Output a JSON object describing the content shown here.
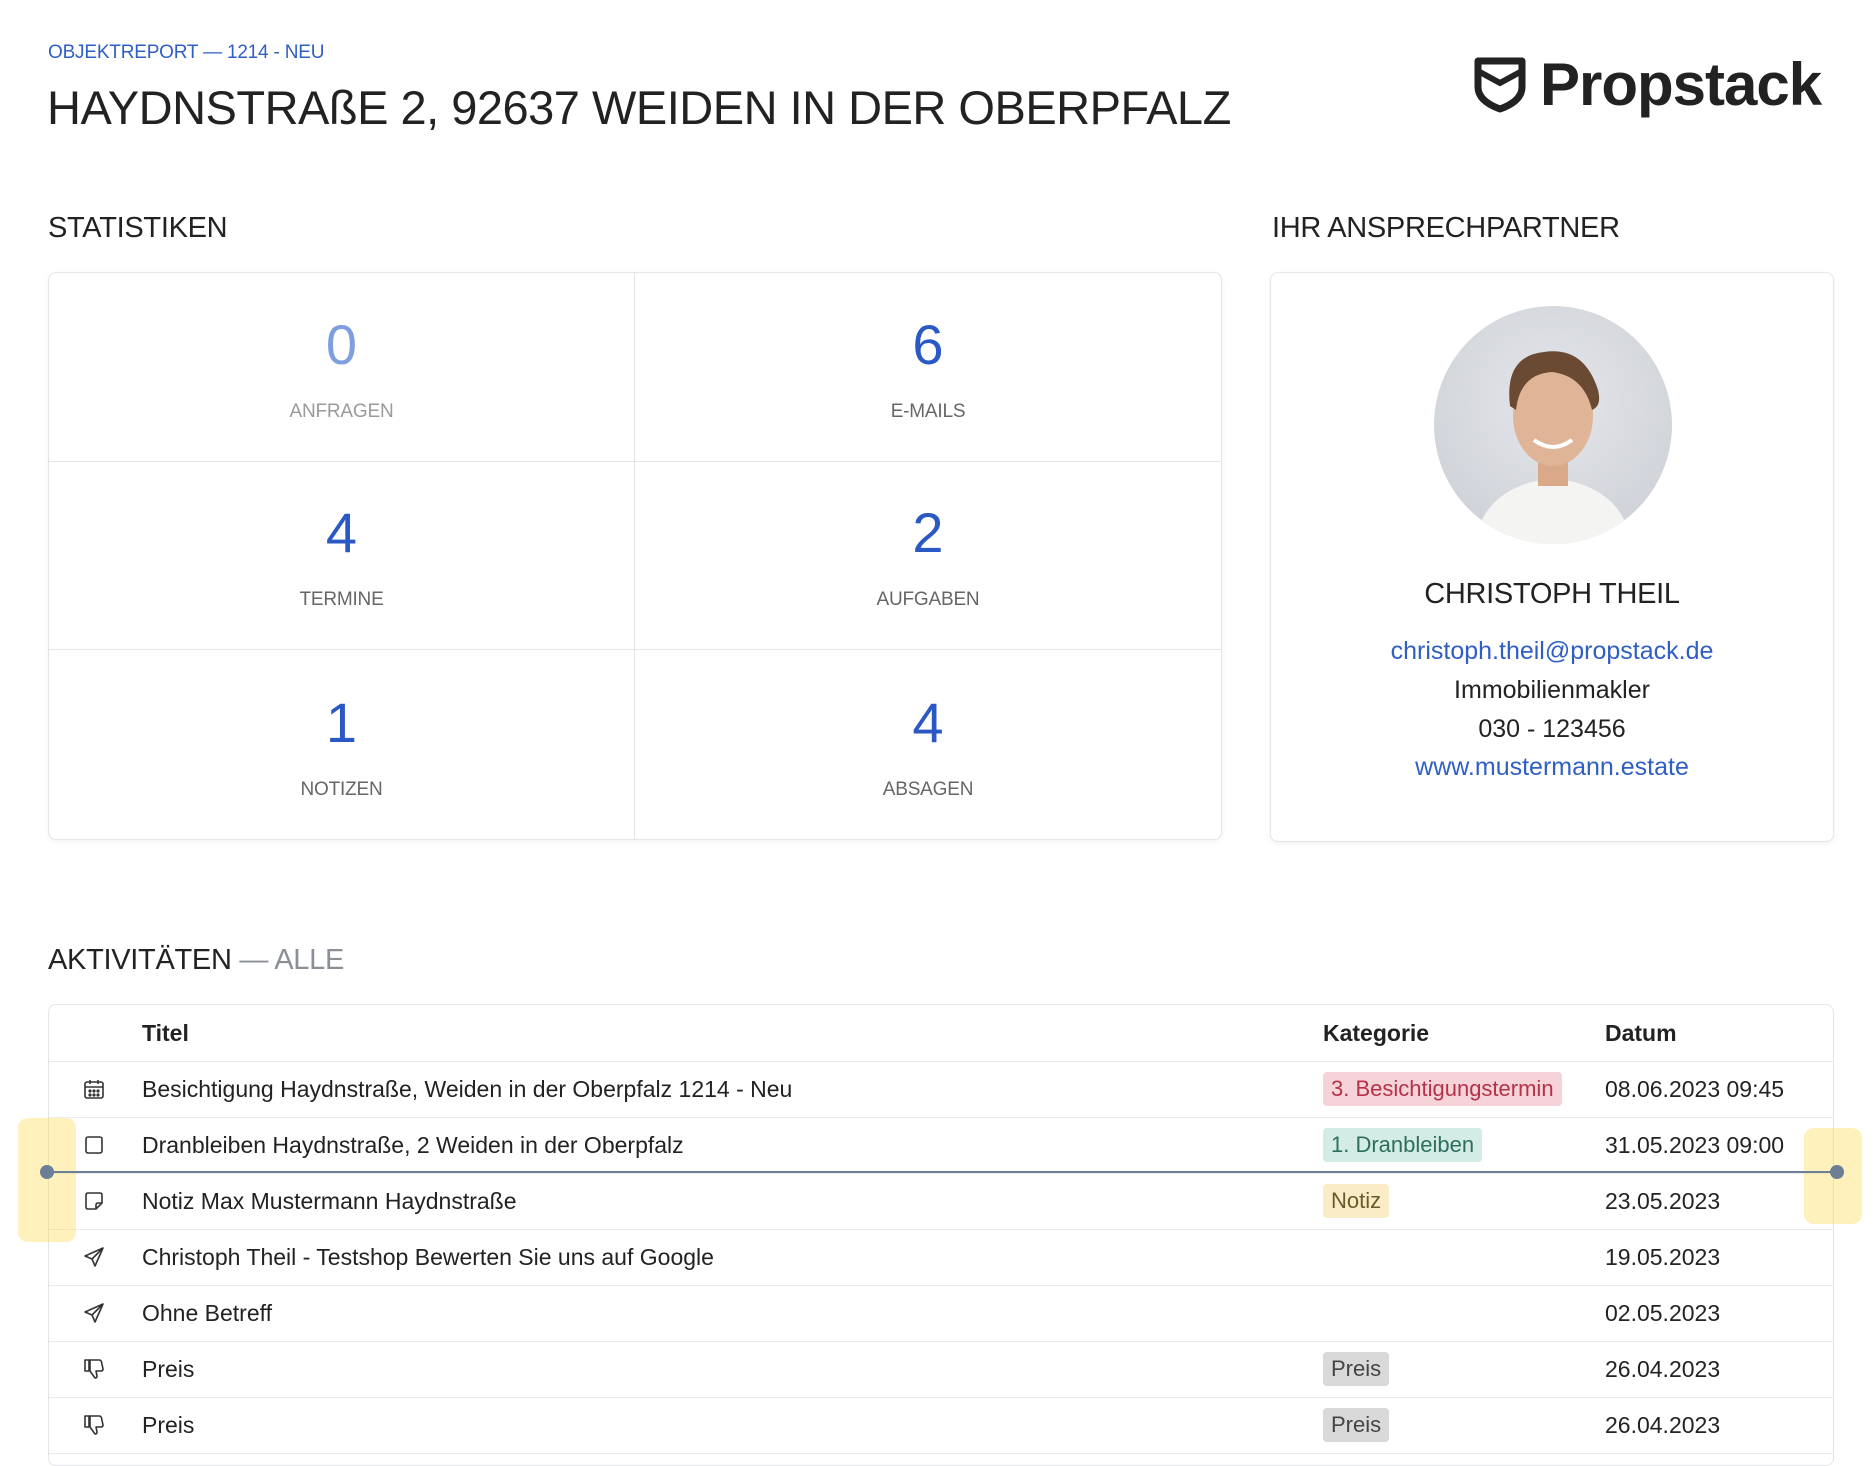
{
  "header": {
    "subtitle": "OBJEKTREPORT — 1214 - NEU",
    "title": "HAYDNSTRAßE 2, 92637 WEIDEN IN DER OBERPFALZ",
    "logo_text": "Propstack"
  },
  "stats": {
    "heading": "STATISTIKEN",
    "items": [
      {
        "value": "0",
        "label": "ANFRAGEN"
      },
      {
        "value": "6",
        "label": "E-MAILS"
      },
      {
        "value": "4",
        "label": "TERMINE"
      },
      {
        "value": "2",
        "label": "AUFGABEN"
      },
      {
        "value": "1",
        "label": "NOTIZEN"
      },
      {
        "value": "4",
        "label": "ABSAGEN"
      }
    ]
  },
  "contact": {
    "heading": "IHR ANSPRECHPARTNER",
    "name": "CHRISTOPH THEIL",
    "email": "christoph.theil@propstack.de",
    "role": "Immobilienmakler",
    "phone": "030 - 123456",
    "website": "www.mustermann.estate"
  },
  "activities": {
    "heading": "AKTIVITÄTEN",
    "filter": "— ALLE",
    "columns": {
      "title": "Titel",
      "category": "Kategorie",
      "date": "Datum"
    },
    "rows": [
      {
        "icon": "calendar-icon",
        "title": "Besichtigung Haydnstraße, Weiden in der Oberpfalz 1214 - Neu",
        "category": "3. Besichtigungstermin",
        "cat_bg": "#f6d3d8",
        "cat_fg": "#b4324a",
        "date": "08.06.2023 09:45"
      },
      {
        "icon": "checkbox-icon",
        "title": "Dranbleiben Haydnstraße, 2 Weiden in der Oberpfalz",
        "category": "1. Dranbleiben",
        "cat_bg": "#d4ece6",
        "cat_fg": "#2d6e5e",
        "date": "31.05.2023 09:00"
      },
      {
        "icon": "note-icon",
        "title": "Notiz Max Mustermann Haydnstraße",
        "category": "Notiz",
        "cat_bg": "#fbecc8",
        "cat_fg": "#6b5a2a",
        "date": "23.05.2023"
      },
      {
        "icon": "send-icon",
        "title": "Christoph Theil - Testshop Bewerten Sie uns auf Google",
        "category": "",
        "cat_bg": "",
        "cat_fg": "",
        "date": "19.05.2023"
      },
      {
        "icon": "send-icon",
        "title": "Ohne Betreff",
        "category": "",
        "cat_bg": "",
        "cat_fg": "",
        "date": "02.05.2023"
      },
      {
        "icon": "thumbs-down-icon",
        "title": "Preis",
        "category": "Preis",
        "cat_bg": "#d9d9d9",
        "cat_fg": "#444444",
        "date": "26.04.2023"
      },
      {
        "icon": "thumbs-down-icon",
        "title": "Preis",
        "category": "Preis",
        "cat_bg": "#d9d9d9",
        "cat_fg": "#444444",
        "date": "26.04.2023"
      }
    ]
  }
}
